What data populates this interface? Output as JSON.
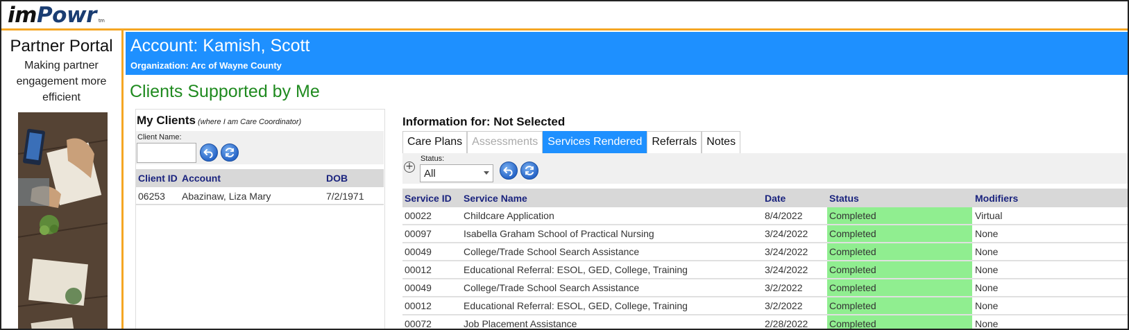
{
  "brand": {
    "logo_im": "im",
    "logo_powr": "Powr",
    "logo_tm": "tm"
  },
  "sidebar": {
    "title": "Partner Portal",
    "subtitle": "Making partner engagement more efficient"
  },
  "account": {
    "title": "Account: Kamish, Scott",
    "organization": "Organization: Arc of Wayne County"
  },
  "page_title": "Clients Supported by Me",
  "my_clients": {
    "title": "My Clients",
    "note": "(where I am Care Coordinator)",
    "filter_label": "Client Name:",
    "filter_value": "",
    "columns": [
      "Client ID",
      "Account",
      "DOB"
    ],
    "rows": [
      {
        "id": "06253",
        "account": "Abazinaw, Liza Mary",
        "dob": "7/2/1971"
      }
    ]
  },
  "info": {
    "title": "Information for: Not Selected",
    "tabs": [
      {
        "label": "Care Plans",
        "state": "normal"
      },
      {
        "label": "Assessments",
        "state": "disabled"
      },
      {
        "label": "Services Rendered",
        "state": "active"
      },
      {
        "label": "Referrals",
        "state": "normal"
      },
      {
        "label": "Notes",
        "state": "normal"
      }
    ],
    "status_label": "Status:",
    "status_value": "All",
    "columns": [
      "Service ID",
      "Service Name",
      "Date",
      "Status",
      "Modifiers"
    ],
    "status_color": "#90ee90",
    "rows": [
      {
        "id": "00022",
        "name": "Childcare Application",
        "date": "8/4/2022",
        "status": "Completed",
        "modifiers": "Virtual"
      },
      {
        "id": "00097",
        "name": "Isabella Graham School of Practical Nursing",
        "date": "3/24/2022",
        "status": "Completed",
        "modifiers": "None"
      },
      {
        "id": "00049",
        "name": "College/Trade School Search Assistance",
        "date": "3/24/2022",
        "status": "Completed",
        "modifiers": "None"
      },
      {
        "id": "00012",
        "name": "Educational Referral: ESOL, GED, College, Training",
        "date": "3/24/2022",
        "status": "Completed",
        "modifiers": "None"
      },
      {
        "id": "00049",
        "name": "College/Trade School Search Assistance",
        "date": "3/2/2022",
        "status": "Completed",
        "modifiers": "None"
      },
      {
        "id": "00012",
        "name": "Educational Referral: ESOL, GED, College, Training",
        "date": "3/2/2022",
        "status": "Completed",
        "modifiers": "None"
      },
      {
        "id": "00072",
        "name": "Job Placement Assistance",
        "date": "2/28/2022",
        "status": "Completed",
        "modifiers": "None"
      }
    ]
  },
  "colors": {
    "accent_orange": "#f5a623",
    "banner_blue": "#1e90ff",
    "title_green": "#1f8a1f",
    "header_navy": "#1a237e"
  }
}
